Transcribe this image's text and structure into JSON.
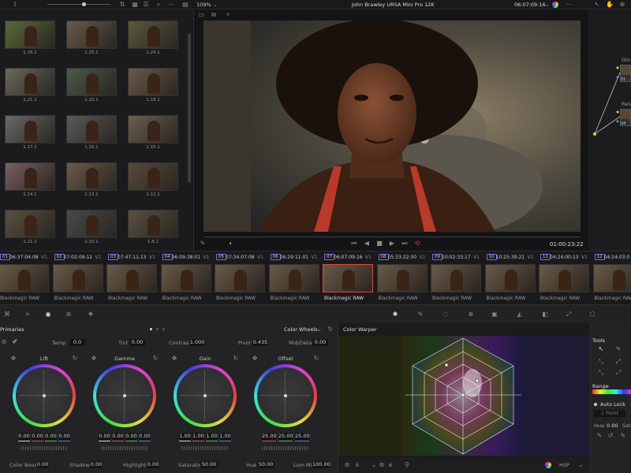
{
  "topbar": {
    "zoom": "109%",
    "title": "John Brawley URSA Mini Pro 12K",
    "timecode": "06:07:09:16"
  },
  "gallery": {
    "items": [
      {
        "label": "1.26.1"
      },
      {
        "label": "1.25.1"
      },
      {
        "label": "1.24.1"
      },
      {
        "label": "1.21.1"
      },
      {
        "label": "1.20.1"
      },
      {
        "label": "1.19.1"
      },
      {
        "label": "1.17.1"
      },
      {
        "label": "1.16.1"
      },
      {
        "label": "1.15.1"
      },
      {
        "label": "1.14.1"
      },
      {
        "label": "1.13.1"
      },
      {
        "label": "1.12.1"
      },
      {
        "label": "1.11.1"
      },
      {
        "label": "1.10.1"
      },
      {
        "label": "1.8.1"
      }
    ]
  },
  "viewer": {
    "timecode": "01:00:23:22"
  },
  "nodes": {
    "n1_label": "Glo",
    "n1_num": "01",
    "n2_label": "Rela",
    "n2_num": "04"
  },
  "clips": [
    {
      "num": "01",
      "tc": "06:37:04:08",
      "track": "V1",
      "label": "Blackmagic RAW"
    },
    {
      "num": "02",
      "tc": "07:02:09:12",
      "track": "V1",
      "label": "Blackmagic RAW"
    },
    {
      "num": "03",
      "tc": "07:47:11:13",
      "track": "V1",
      "label": "Blackmagic RAW"
    },
    {
      "num": "04",
      "tc": "06:09:38:01",
      "track": "V1",
      "label": "Blackmagic RAW"
    },
    {
      "num": "05",
      "tc": "07:34:07:08",
      "track": "V1",
      "label": "Blackmagic RAW"
    },
    {
      "num": "06",
      "tc": "06:29:11:01",
      "track": "V1",
      "label": "Blackmagic RAW"
    },
    {
      "num": "07",
      "tc": "06:07:09:16",
      "track": "V1",
      "label": "Blackmagic RAW"
    },
    {
      "num": "08",
      "tc": "05:33:22:00",
      "track": "V1",
      "label": "Blackmagic RAW"
    },
    {
      "num": "09",
      "tc": "10:02:33:17",
      "track": "V1",
      "label": "Blackmagic RAW"
    },
    {
      "num": "10",
      "tc": "10:25:39:21",
      "track": "V1",
      "label": "Blackmagic RAW"
    },
    {
      "num": "11",
      "tc": "04:24:00:13",
      "track": "V1",
      "label": "Blackmagic RAW"
    },
    {
      "num": "12",
      "tc": "04:24:03:0",
      "track": "V1",
      "label": "Blackmagic RAW"
    }
  ],
  "primaries": {
    "title": "Primaries",
    "mode": "Color Wheels",
    "params_top": [
      {
        "label": "Temp",
        "value": "0.0"
      },
      {
        "label": "Tint",
        "value": "0.00"
      },
      {
        "label": "Contrast",
        "value": "1.000"
      },
      {
        "label": "Pivot",
        "value": "0.435"
      },
      {
        "label": "Mid/Detail",
        "value": "0.00"
      }
    ],
    "wheels": [
      {
        "name": "Lift",
        "values": [
          "0.00",
          "0.00",
          "0.00",
          "0.00"
        ]
      },
      {
        "name": "Gamma",
        "values": [
          "0.00",
          "0.00",
          "0.00",
          "0.00"
        ]
      },
      {
        "name": "Gain",
        "values": [
          "1.00",
          "1.00",
          "1.00",
          "1.00"
        ]
      },
      {
        "name": "Offset",
        "values": [
          "25.00",
          "25.00",
          "25.00"
        ]
      }
    ],
    "params_bottom": [
      {
        "label": "Color Boost",
        "value": "0.00"
      },
      {
        "label": "Shadows",
        "value": "0.00"
      },
      {
        "label": "Highlights",
        "value": "0.00"
      },
      {
        "label": "Saturation",
        "value": "50.00"
      },
      {
        "label": "Hue",
        "value": "50.00"
      },
      {
        "label": "Lum Mix",
        "value": "100.00"
      }
    ]
  },
  "warper": {
    "title": "Color Warper",
    "grid_a": "6",
    "grid_b": "6",
    "mode": "HSP"
  },
  "tools": {
    "title": "Tools",
    "range_label": "Range",
    "auto_lock": "Auto Lock",
    "pickup": "1 Point",
    "hue_label": "Hue",
    "hue_value": "0.00",
    "sat_label": "Sat"
  },
  "colors": {
    "accent": "#7a6be0",
    "bg": "#1e1e20",
    "panel": "#232326",
    "selected": "#e0483c"
  }
}
